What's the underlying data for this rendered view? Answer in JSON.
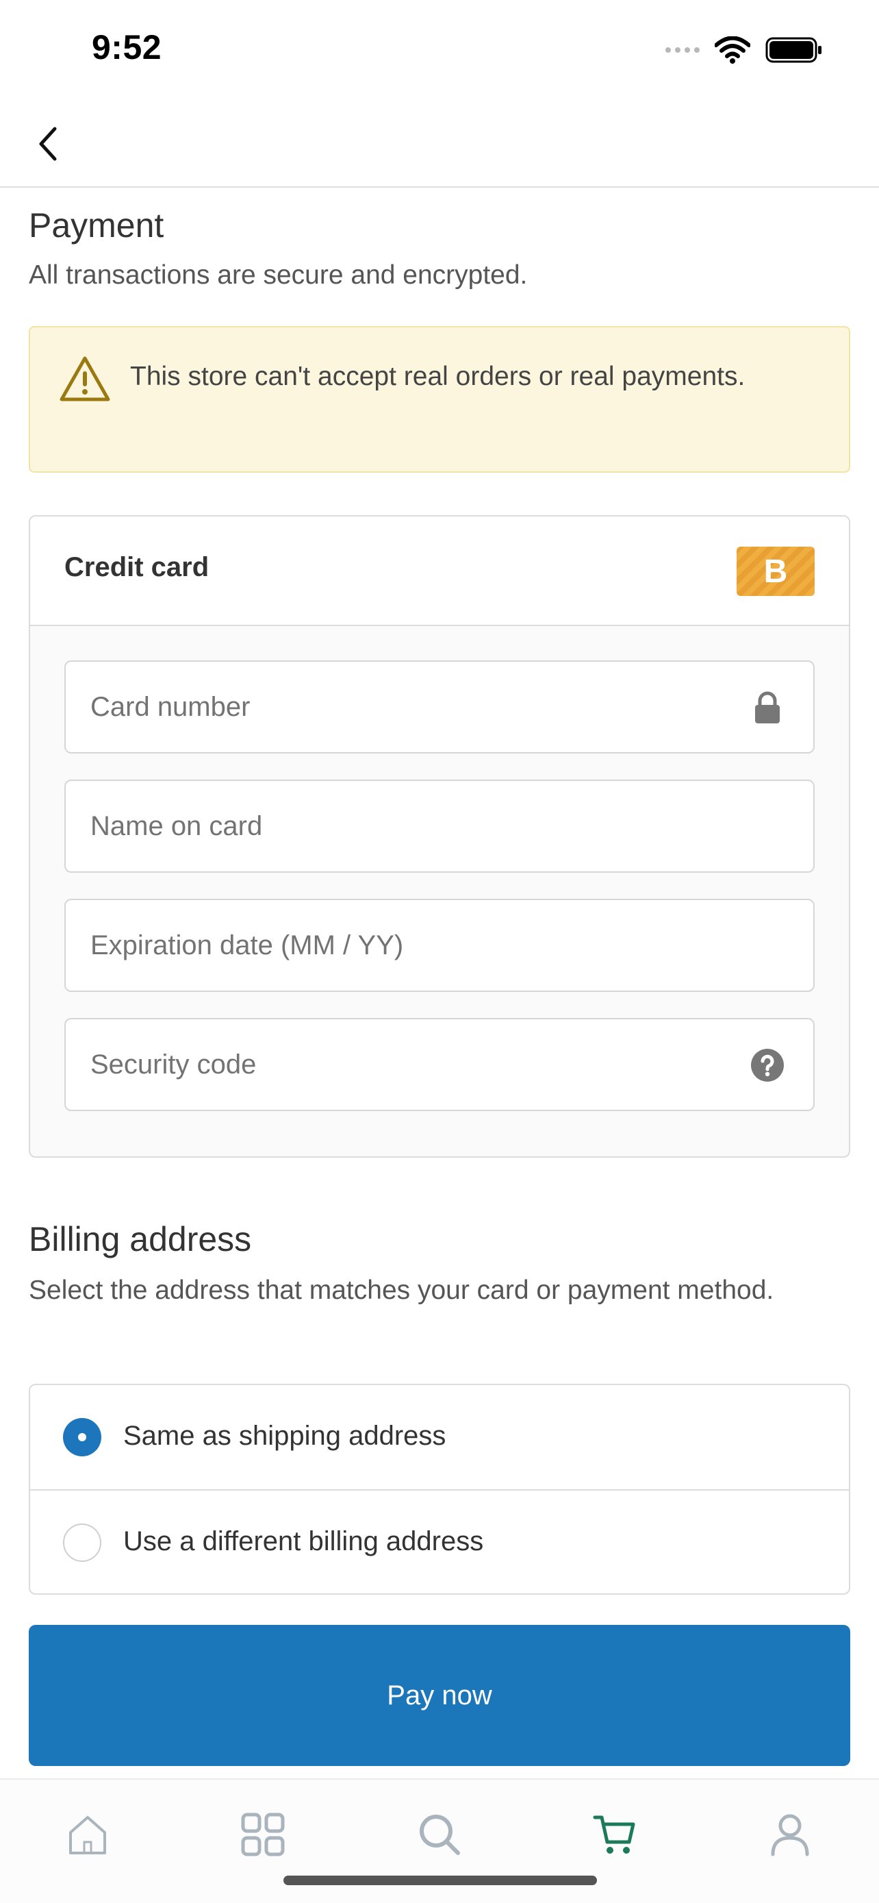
{
  "status_bar": {
    "time": "9:52"
  },
  "payment": {
    "title": "Payment",
    "subtitle": "All transactions are secure and encrypted.",
    "notice": "This store can't accept real orders or real payments."
  },
  "credit_card": {
    "title": "Credit card",
    "badge": "B",
    "fields": {
      "card_number_placeholder": "Card number",
      "name_placeholder": "Name on card",
      "expiration_placeholder": "Expiration date (MM / YY)",
      "security_placeholder": "Security code"
    }
  },
  "billing": {
    "title": "Billing address",
    "subtitle": "Select the address that matches your card or payment method.",
    "options": [
      {
        "label": "Same as shipping address",
        "selected": true
      },
      {
        "label": "Use a different billing address",
        "selected": false
      }
    ]
  },
  "pay_button": {
    "label": "Pay now"
  },
  "tab_bar": {
    "tabs": [
      "home-icon",
      "grid-icon",
      "search-icon",
      "cart-icon",
      "account-icon"
    ],
    "active": "cart-icon"
  },
  "colors": {
    "accent": "#1c76ba",
    "notice_bg": "#fdf6de",
    "badge": "#e9a032",
    "active_tab": "#1b7a5a"
  }
}
